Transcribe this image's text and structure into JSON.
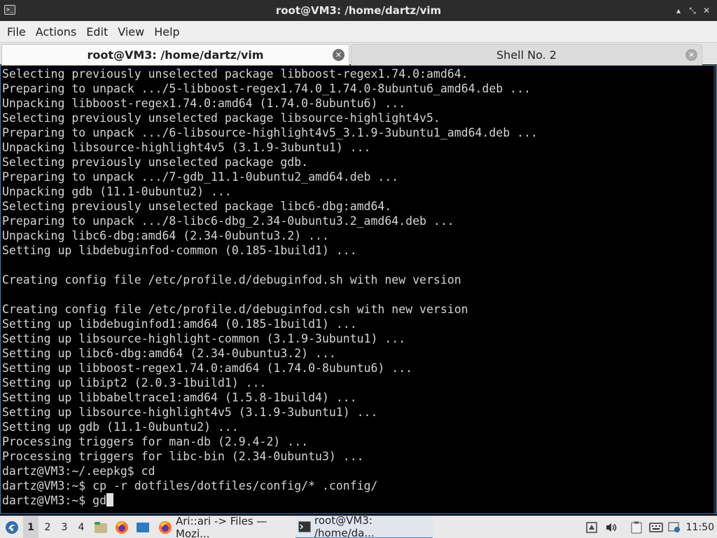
{
  "window": {
    "title": "root@VM3: /home/dartz/vim",
    "icons": [
      "terminal-app-icon",
      "minimize-icon",
      "maximize-icon",
      "close-icon"
    ],
    "controls": {
      "minimize": "▴",
      "maximize": "⤡",
      "close": "✕"
    }
  },
  "menubar": {
    "items": [
      "File",
      "Actions",
      "Edit",
      "View",
      "Help"
    ]
  },
  "tabs": [
    {
      "label": "root@VM3: /home/dartz/vim",
      "active": true
    },
    {
      "label": "Shell No. 2",
      "active": false
    }
  ],
  "terminal": {
    "lines": [
      "Selecting previously unselected package libboost-regex1.74.0:amd64.",
      "Preparing to unpack .../5-libboost-regex1.74.0_1.74.0-8ubuntu6_amd64.deb ...",
      "Unpacking libboost-regex1.74.0:amd64 (1.74.0-8ubuntu6) ...",
      "Selecting previously unselected package libsource-highlight4v5.",
      "Preparing to unpack .../6-libsource-highlight4v5_3.1.9-3ubuntu1_amd64.deb ...",
      "Unpacking libsource-highlight4v5 (3.1.9-3ubuntu1) ...",
      "Selecting previously unselected package gdb.",
      "Preparing to unpack .../7-gdb_11.1-0ubuntu2_amd64.deb ...",
      "Unpacking gdb (11.1-0ubuntu2) ...",
      "Selecting previously unselected package libc6-dbg:amd64.",
      "Preparing to unpack .../8-libc6-dbg_2.34-0ubuntu3.2_amd64.deb ...",
      "Unpacking libc6-dbg:amd64 (2.34-0ubuntu3.2) ...",
      "Setting up libdebuginfod-common (0.185-1build1) ...",
      "",
      "Creating config file /etc/profile.d/debuginfod.sh with new version",
      "",
      "Creating config file /etc/profile.d/debuginfod.csh with new version",
      "Setting up libdebuginfod1:amd64 (0.185-1build1) ...",
      "Setting up libsource-highlight-common (3.1.9-3ubuntu1) ...",
      "Setting up libc6-dbg:amd64 (2.34-0ubuntu3.2) ...",
      "Setting up libboost-regex1.74.0:amd64 (1.74.0-8ubuntu6) ...",
      "Setting up libipt2 (2.0.3-1build1) ...",
      "Setting up libbabeltrace1:amd64 (1.5.8-1build4) ...",
      "Setting up libsource-highlight4v5 (3.1.9-3ubuntu1) ...",
      "Setting up gdb (11.1-0ubuntu2) ...",
      "Processing triggers for man-db (2.9.4-2) ...",
      "Processing triggers for libc-bin (2.34-0ubuntu3) ...",
      "dartz@VM3:~/.eepkg$ cd",
      "dartz@VM3:~$ cp -r dotfiles/dotfiles/config/* .config/"
    ],
    "prompt": "dartz@VM3:~$ ",
    "current_input": "gd"
  },
  "taskbar": {
    "start_icon": "distro-menu-icon",
    "workspaces": [
      "1",
      "2",
      "3",
      "4"
    ],
    "active_workspace": "1",
    "quick_launch": [
      "file-manager-icon",
      "firefox-icon",
      "desktop-icon"
    ],
    "tasks": [
      {
        "icon": "firefox-icon",
        "label": "Ari::ari -> Files — Mozi...",
        "active": false
      },
      {
        "icon": "terminal-icon",
        "label": "root@VM3: /home/da...",
        "active": true
      }
    ],
    "tray": [
      "network-icon",
      "volume-icon",
      "clipboard-icon",
      "keyboard-icon",
      "updates-icon"
    ],
    "clock": "11:50"
  }
}
